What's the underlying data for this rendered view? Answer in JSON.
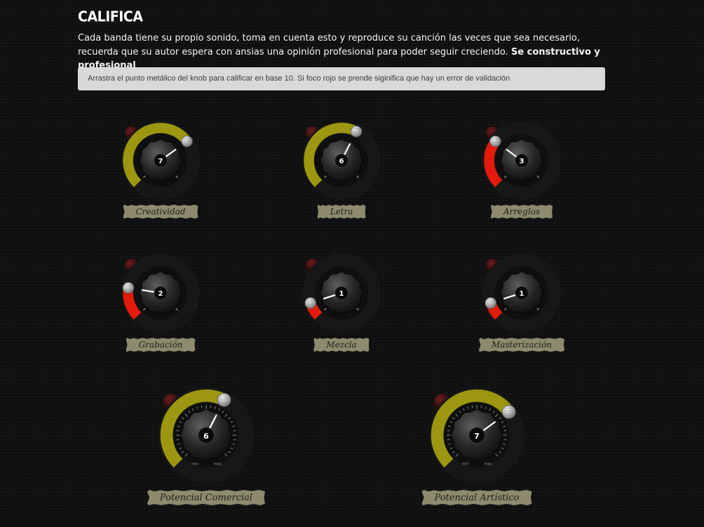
{
  "page": {
    "title": "CALIFICA",
    "intro_text": "Cada banda tiene su propio sonido, toma en cuenta esto y reproduce su canción las veces que sea necesario, recuerda que su autor espera con ansias una opinión profesional para poder seguir creciendo.",
    "intro_emphasis": "Se constructivo y profesional",
    "hint": "Arrastra el punto metálico del knob para calificar en base 10. Si foco rojo se prende siginifica que hay un error de validación"
  },
  "colors": {
    "ok_arc": "#9c9611",
    "error_arc": "#e41a0c",
    "label_bg": "#8e8a6f",
    "indicator_led": "#3a0d0d"
  },
  "knobs": [
    {
      "label": "Creatividad",
      "value": 7,
      "scale_max": 10,
      "error": false
    },
    {
      "label": "Letra",
      "value": 6,
      "scale_max": 10,
      "error": false
    },
    {
      "label": "Arreglos",
      "value": 3,
      "scale_max": 10,
      "error": true
    },
    {
      "label": "Grabación",
      "value": 2,
      "scale_max": 10,
      "error": true
    },
    {
      "label": "Mezcla",
      "value": 1,
      "scale_max": 10,
      "error": true
    },
    {
      "label": "Masterización",
      "value": 1,
      "scale_max": 10,
      "error": true
    },
    {
      "label": "Potencial Comercial",
      "value": 6,
      "scale_max": 10,
      "error": false,
      "min_label": "min",
      "max_label": "max"
    },
    {
      "label": "Potencial Artístico",
      "value": 7,
      "scale_max": 10,
      "error": false,
      "min_label": "min",
      "max_label": "max"
    }
  ]
}
